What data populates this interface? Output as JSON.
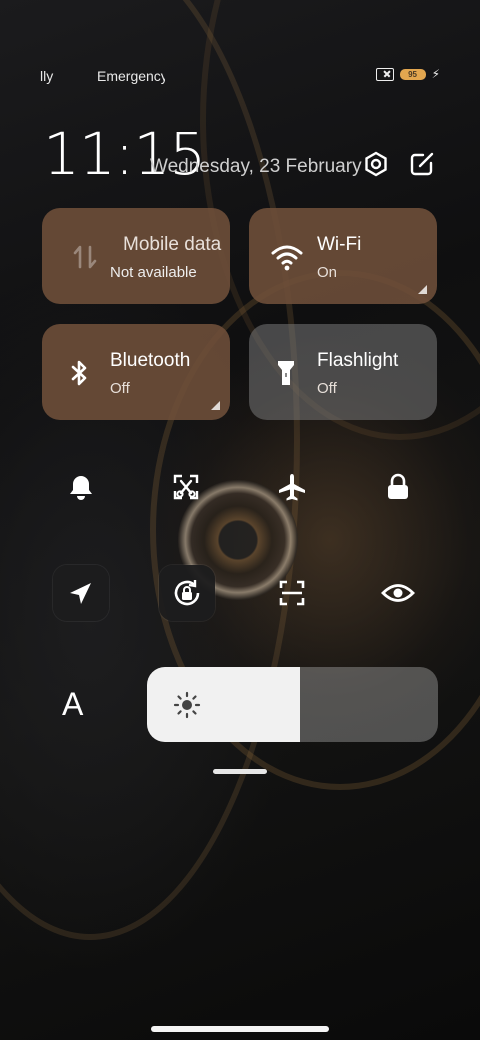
{
  "status_bar": {
    "carrier_1": "lly",
    "carrier_2": "Emergency",
    "battery_level": "95"
  },
  "header": {
    "time": "11:15",
    "date": "Wednesday, 23 February"
  },
  "tiles": {
    "mobile_data": {
      "title": "Mobile data",
      "subtitle": "Not available"
    },
    "wifi": {
      "title": "Wi-Fi",
      "subtitle": "On"
    },
    "bluetooth": {
      "title": "Bluetooth",
      "subtitle": "Off"
    },
    "flashlight": {
      "title": "Flashlight",
      "subtitle": "Off"
    }
  },
  "toggles_row1": [
    "bell-icon",
    "screenshot-icon",
    "airplane-icon",
    "lock-icon"
  ],
  "toggles_row2": [
    "location-icon",
    "rotation-lock-icon",
    "scan-icon",
    "eye-icon"
  ],
  "font_button": "A",
  "brightness": {
    "level": 0.525
  },
  "colors": {
    "tile_active": "#70503a",
    "tile_inactive": "#787878",
    "battery": "#e2a64f"
  }
}
